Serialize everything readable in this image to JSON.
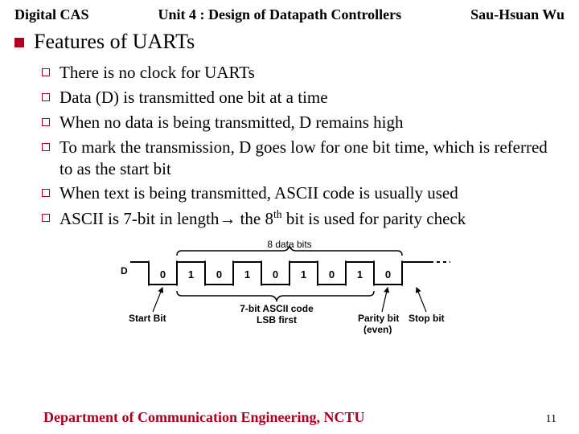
{
  "header": {
    "left": "Digital CAS",
    "mid": "Unit 4 : Design of Datapath Controllers",
    "right": "Sau-Hsuan Wu"
  },
  "title": "Features of UARTs",
  "items": [
    "There is no clock for UARTs",
    "Data (D) is transmitted one bit at a time",
    "When no data is being transmitted, D remains high",
    "To mark the transmission, D goes low for one bit time, which is referred to as the start bit",
    "When text is being transmitted, ASCII code is usually used"
  ],
  "item6_a": "ASCII is 7-bit in length",
  "item6_b": " the 8",
  "item6_c": "th",
  "item6_d": " bit is used for parity check",
  "diagram": {
    "top": "8 data bits",
    "d": "D",
    "bits": [
      "0",
      "1",
      "0",
      "1",
      "0",
      "1",
      "0",
      "1",
      "0"
    ],
    "lbl_start": "Start Bit",
    "lbl_ascii1": "7-bit ASCII code",
    "lbl_ascii2": "LSB first",
    "lbl_parity": "Parity bit",
    "lbl_paren": "(even)",
    "lbl_stop": "Stop bit"
  },
  "footer": {
    "dept": "Department of Communication Engineering, NCTU",
    "page": "11"
  }
}
